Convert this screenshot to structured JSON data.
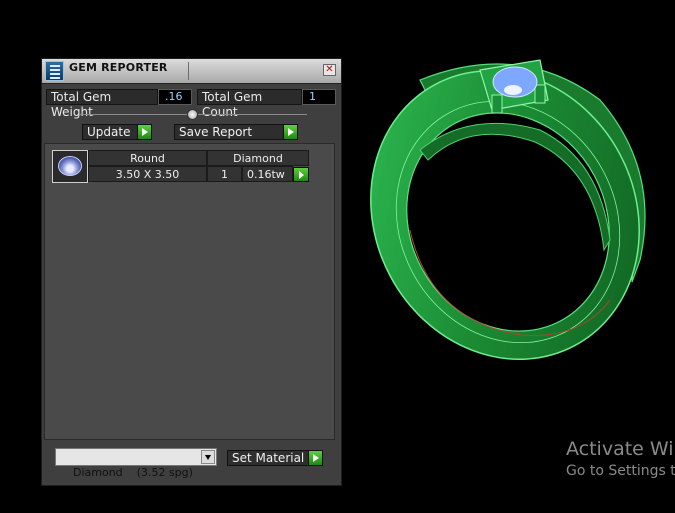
{
  "panel": {
    "title": "GEM REPORTER",
    "close_glyph": "✕",
    "icons": {
      "app": "gem-reporter-app-icon",
      "close": "close-icon",
      "apply": "play-arrow-icon"
    },
    "total_weight_label": "Total Gem Weight",
    "total_weight_value": ".16",
    "total_count_label": "Total Gem Count",
    "total_count_value": "1",
    "update_label": "Update",
    "save_report_label": "Save Report",
    "gems": [
      {
        "shape": "Round",
        "size": "3.50 X 3.50",
        "material": "Diamond",
        "count": "1",
        "weight": "0.16tw"
      }
    ],
    "material_select": "Diamond    (3.52 spg)",
    "set_material_label": "Set Material"
  },
  "viewport": {
    "model": "ring-with-round-diamond",
    "ring_color": "#1f9a3c",
    "gem_color": "#8ab4ff"
  },
  "watermark": {
    "line1": "Activate Win",
    "line2": "Go to Settings to"
  }
}
